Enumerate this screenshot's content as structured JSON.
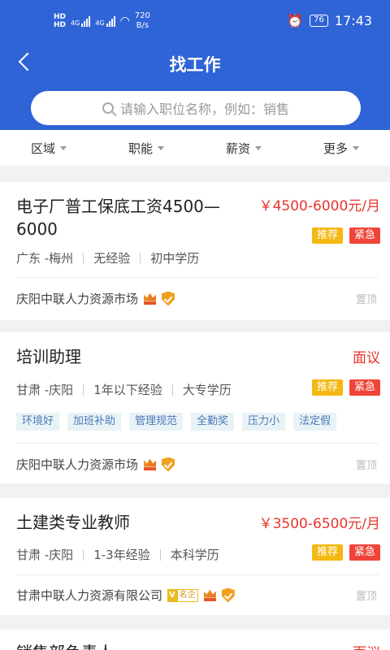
{
  "status_bar": {
    "hd1": "HD",
    "hd2": "HD",
    "net1": "4G",
    "net2": "4G",
    "speed_value": "720",
    "speed_unit": "B/s",
    "battery": "76",
    "time": "17:43"
  },
  "header": {
    "title": "找工作"
  },
  "search": {
    "placeholder": "请输入职位名称，例如：销售"
  },
  "filters": [
    "区域",
    "职能",
    "薪资",
    "更多"
  ],
  "jobs": [
    {
      "title_line1": "电子厂普工保底工资4500—",
      "title_line2": "6000",
      "salary": "￥4500-6000元/月",
      "location": "广东 -梅州",
      "experience": "无经验",
      "education": "初中学历",
      "badge_rec": "推荐",
      "badge_urg": "紧急",
      "company": "庆阳中联人力资源市场",
      "pin": "置顶"
    },
    {
      "title_line1": "培训助理",
      "salary": "面议",
      "location": "甘肃 -庆阳",
      "experience": "1年以下经验",
      "education": "大专学历",
      "badge_rec": "推荐",
      "badge_urg": "紧急",
      "tags": [
        "环境好",
        "加班补助",
        "管理规范",
        "全勤奖",
        "压力小",
        "法定假"
      ],
      "company": "庆阳中联人力资源市场",
      "pin": "置顶"
    },
    {
      "title_line1": "土建类专业教师",
      "salary": "￥3500-6500元/月",
      "location": "甘肃 -庆阳",
      "experience": "1-3年经验",
      "education": "本科学历",
      "badge_rec": "推荐",
      "badge_urg": "紧急",
      "company": "甘肃中联人力资源有限公司",
      "vip_v": "V",
      "vip_label": "名企",
      "pin": "置顶"
    },
    {
      "title_line1": "销售部负责人",
      "salary": "面议"
    }
  ]
}
